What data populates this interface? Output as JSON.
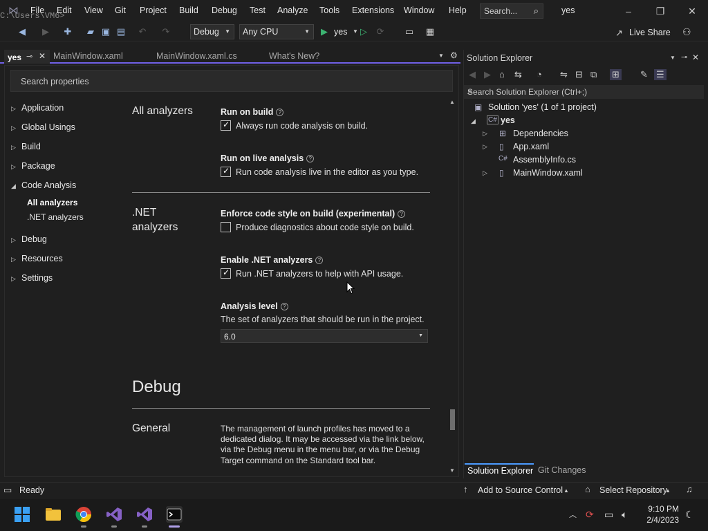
{
  "titlebar": {
    "path_ghost": "C:\\Users\\VM6>",
    "menu": [
      "File",
      "Edit",
      "View",
      "Git",
      "Project",
      "Build",
      "Debug",
      "Test",
      "Analyze",
      "Tools",
      "Extensions",
      "Window",
      "Help"
    ],
    "search_placeholder": "Search...",
    "project_name": "yes",
    "minimize": "–",
    "restore": "❐",
    "close": "✕"
  },
  "toolbar": {
    "config": "Debug",
    "platform": "Any CPU",
    "run_target": "yes",
    "live_share": "Live Share"
  },
  "doc_tabs": {
    "active": "yes",
    "tabs": [
      "MainWindow.xaml",
      "MainWindow.xaml.cs",
      "What's New?"
    ]
  },
  "properties": {
    "search_placeholder": "Search properties",
    "nav": [
      {
        "label": "Application"
      },
      {
        "label": "Global Usings"
      },
      {
        "label": "Build"
      },
      {
        "label": "Package"
      },
      {
        "label": "Code Analysis"
      },
      {
        "label": "Debug"
      },
      {
        "label": "Resources"
      },
      {
        "label": "Settings"
      }
    ],
    "nav_sub": [
      "All analyzers",
      ".NET analyzers"
    ],
    "sections": {
      "all_analyzers": "All analyzers",
      "net_analyzers_1": ".NET",
      "net_analyzers_2": "analyzers",
      "debug": "Debug",
      "general": "General"
    },
    "options": {
      "run_on_build_title": "Run on build",
      "run_on_build_label": "Always run code analysis on build.",
      "run_on_build_checked": true,
      "run_live_title": "Run on live analysis",
      "run_live_label": "Run code analysis live in the editor as you type.",
      "run_live_checked": true,
      "enforce_title": "Enforce code style on build (experimental)",
      "enforce_label": "Produce diagnostics about code style on build.",
      "enforce_checked": false,
      "enable_net_title": "Enable .NET analyzers",
      "enable_net_label": "Run .NET analyzers to help with API usage.",
      "enable_net_checked": true,
      "analysis_level_title": "Analysis level",
      "analysis_level_desc": "The set of analyzers that should be run in the project.",
      "analysis_level_value": "6.0"
    },
    "general_desc": "The management of launch profiles has moved to a dedicated dialog. It may be accessed via the link below, via the Debug menu in the menu bar, or via the Debug Target command on the Standard tool bar."
  },
  "solution_explorer": {
    "title": "Solution Explorer",
    "search_placeholder": "Search Solution Explorer (Ctrl+;)",
    "solution": "Solution 'yes' (1 of 1 project)",
    "project": "yes",
    "items": [
      "Dependencies",
      "App.xaml",
      "AssemblyInfo.cs",
      "MainWindow.xaml"
    ],
    "bottom_tabs": [
      "Solution Explorer",
      "Git Changes"
    ]
  },
  "statusbar": {
    "ready": "Ready",
    "source_control": "Add to Source Control",
    "repository": "Select Repository"
  },
  "taskbar": {
    "time": "9:10 PM",
    "date": "2/4/2023"
  }
}
